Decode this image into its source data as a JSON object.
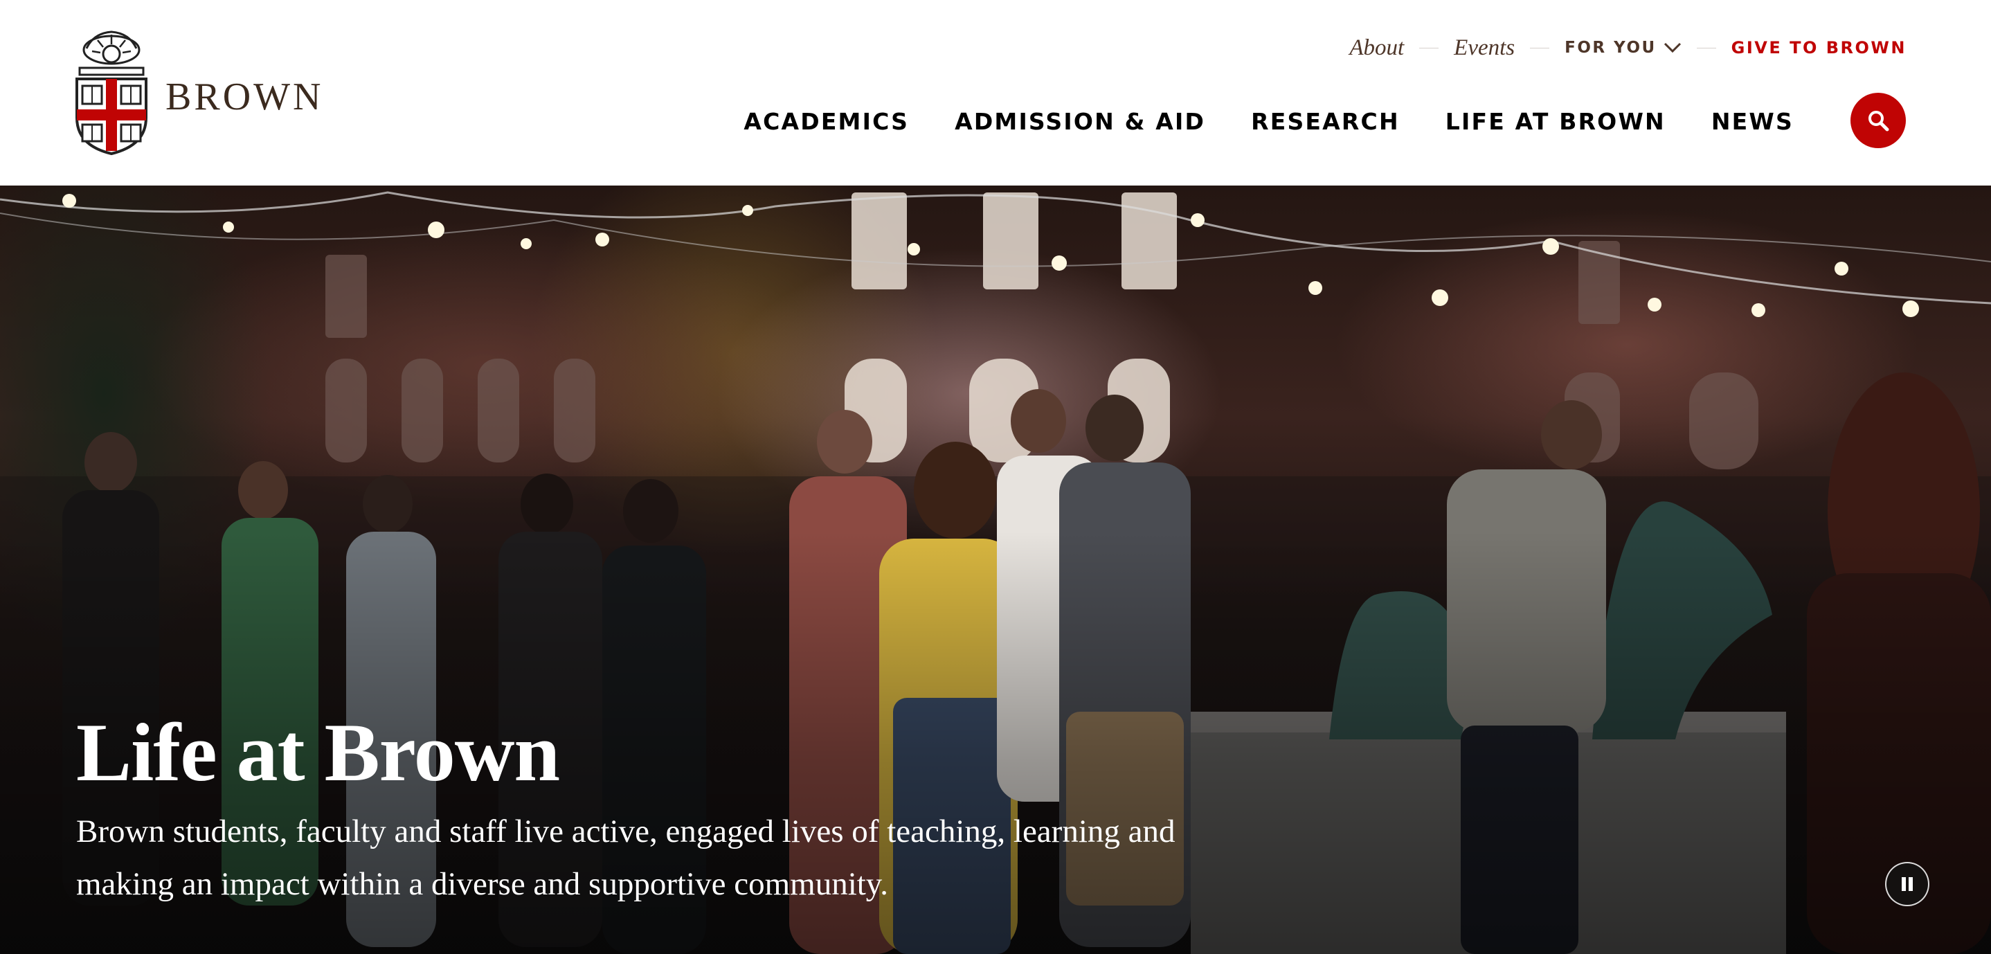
{
  "brand": {
    "wordmark": "BROWN",
    "logo": "brown-university-crest"
  },
  "utility_nav": {
    "about": "About",
    "events": "Events",
    "for_you": "FOR YOU",
    "give": "GIVE TO BROWN"
  },
  "main_nav": {
    "items": [
      {
        "label": "ACADEMICS"
      },
      {
        "label": "ADMISSION & AID"
      },
      {
        "label": "RESEARCH"
      },
      {
        "label": "LIFE AT BROWN"
      },
      {
        "label": "NEWS"
      }
    ]
  },
  "icons": {
    "search": "search-icon",
    "pause": "pause-icon",
    "dropdown": "chevron-down-icon"
  },
  "hero": {
    "title": "Life at Brown",
    "description": "Brown students, faculty and staff live active, engaged lives of teaching, learning and making an impact within a diverse and supportive community."
  },
  "colors": {
    "brand_red": "#c00404",
    "brown_text": "#4e3629",
    "nav_text": "#000000"
  }
}
